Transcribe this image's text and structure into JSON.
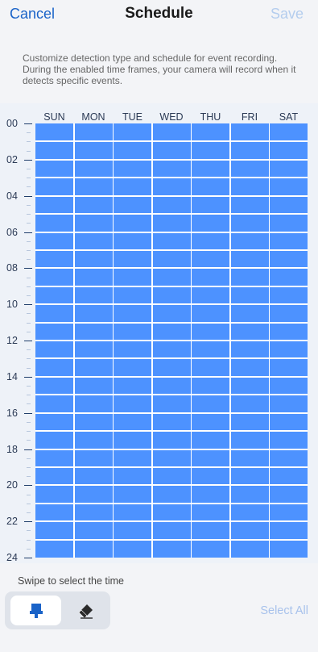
{
  "header": {
    "cancel_label": "Cancel",
    "title": "Schedule",
    "save_label": "Save"
  },
  "description": "Customize detection type and schedule for event recording. During the enabled time frames, your camera will record when it detects specific events.",
  "schedule": {
    "days": [
      "SUN",
      "MON",
      "TUE",
      "WED",
      "THU",
      "FRI",
      "SAT"
    ],
    "hour_labels": [
      "00",
      "02",
      "04",
      "06",
      "08",
      "10",
      "12",
      "14",
      "16",
      "18",
      "20",
      "22",
      "24"
    ],
    "enabled_all_day": [
      true,
      true,
      true,
      true,
      true,
      true,
      true
    ]
  },
  "hint": "Swipe to select the time",
  "tools": {
    "brush_icon": "brush-icon",
    "eraser_icon": "eraser-icon",
    "active": "brush"
  },
  "select_all_label": "Select All",
  "colors": {
    "accent": "#1a63c8",
    "selected_cell": "#4d92ff",
    "disabled_text": "#a8c2ec"
  }
}
